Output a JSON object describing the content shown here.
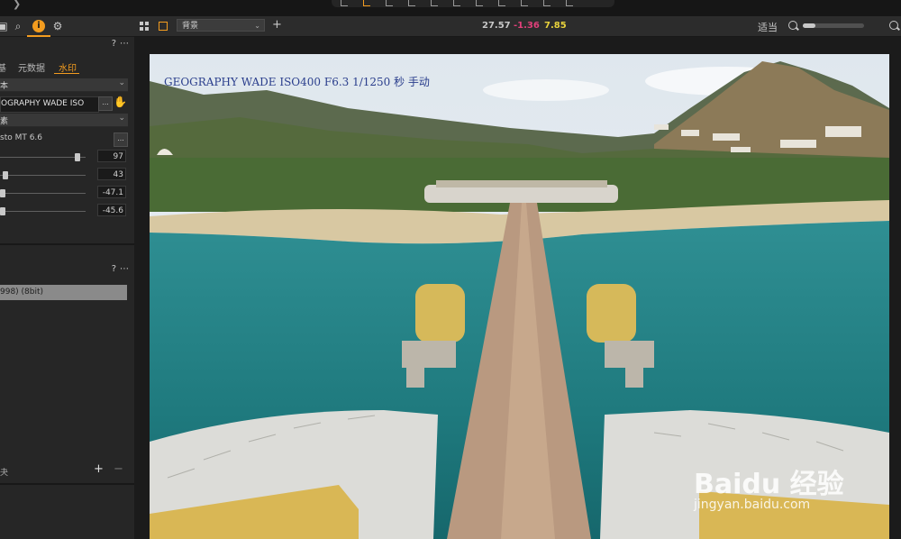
{
  "window": {
    "back_glyph": "❯"
  },
  "left_panel": {
    "tab_icons": [
      "library-icon",
      "search-icon",
      "info-icon",
      "gear-icon"
    ],
    "watermark_section": {
      "help": "?",
      "more": "⋯",
      "subtabs": [
        "基",
        "元数据",
        "水印"
      ],
      "active_subtab": "水印",
      "type_dropdown": "本",
      "text_value": "OGRAPHY WADE  ISO",
      "text_button": "...",
      "unit_dropdown": "素",
      "font_name": "sto MT 6.6",
      "font_button": "...",
      "sliders": [
        {
          "value": "97",
          "level": 0.93
        },
        {
          "value": "43",
          "level": 0.03
        },
        {
          "value": "-47.1",
          "level": 0.0
        },
        {
          "value": "-45.6",
          "level": 0.0
        }
      ]
    },
    "profile_section": {
      "help": "?",
      "more": "⋯",
      "profile_value": "998) (8bit)"
    },
    "footer": {
      "label": "夬",
      "add": "+",
      "remove": "−"
    }
  },
  "viewer_toolbar": {
    "background_select": "背景",
    "add": "+",
    "readouts": [
      {
        "value": "27.57",
        "color": "#c8c8c8"
      },
      {
        "value": "-1.36",
        "color": "#e0407a"
      },
      {
        "value": "7.85",
        "color": "#e8d23c"
      }
    ],
    "fit_label": "适当",
    "zoom_level": 0.2
  },
  "photo": {
    "watermark_text": "GEOGRAPHY WADE  ISO400 F6.3 1/1250 秒 手动",
    "baidu_logo": "Baidu 经验",
    "baidu_url": "jingyan.baidu.com"
  },
  "colors": {
    "accent": "#f39c1f",
    "panel": "#262626",
    "toolbar": "#2c2c2c"
  }
}
